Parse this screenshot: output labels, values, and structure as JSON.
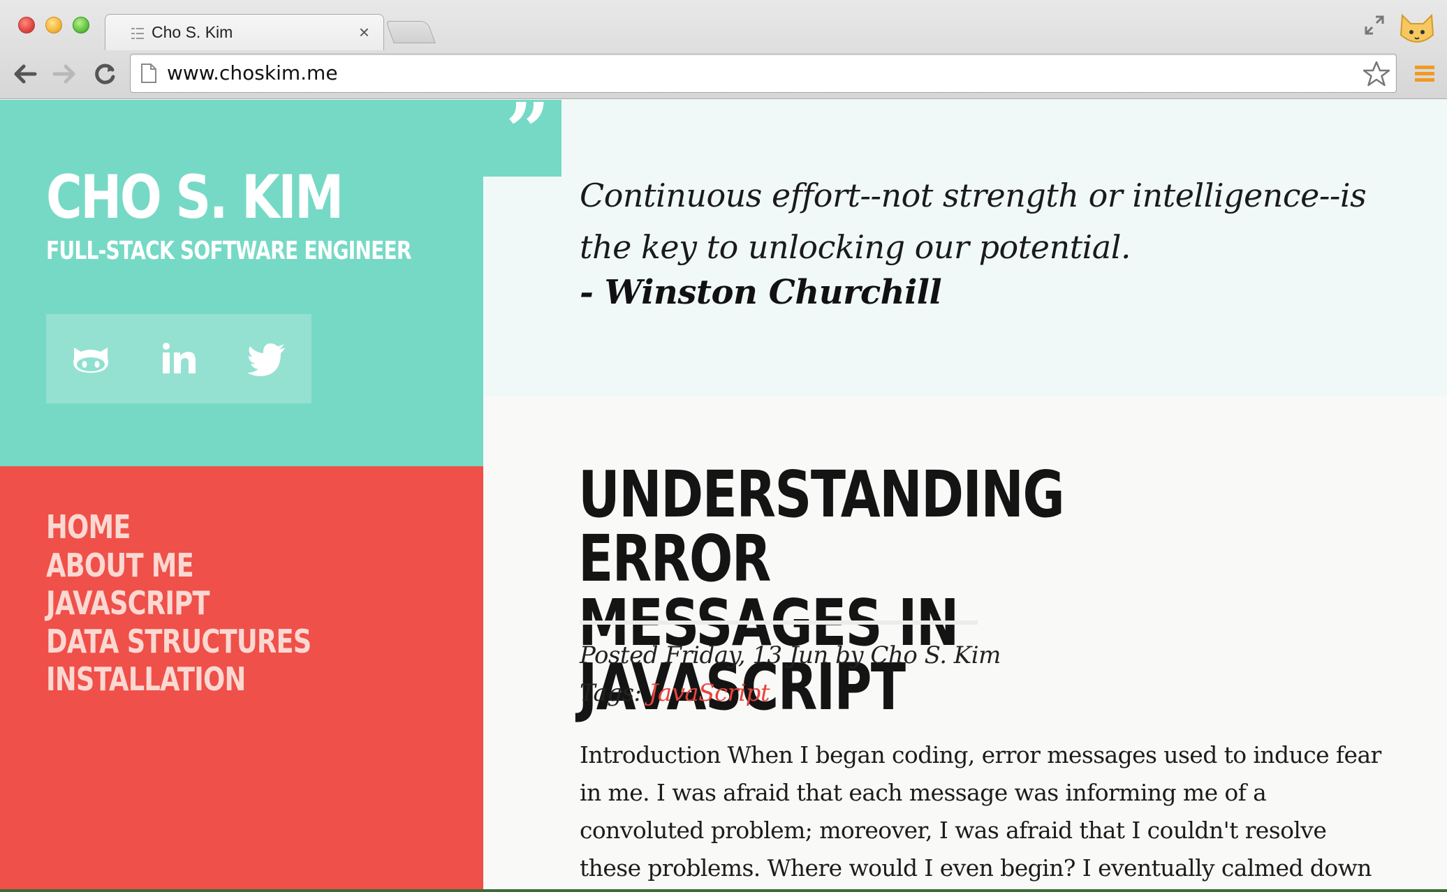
{
  "browser": {
    "tab_title": "Cho S. Kim",
    "tab_close": "×",
    "url": "www.choskim.me"
  },
  "site": {
    "name": "CHO S. KIM",
    "subtitle": "FULL-STACK SOFTWARE ENGINEER",
    "social": [
      "github-icon",
      "linkedin-icon",
      "twitter-icon"
    ]
  },
  "quote": {
    "mark": "”",
    "text": "Continuous effort--not strength or intelligence--is the key to unlocking our potential.",
    "author": "- Winston Churchill"
  },
  "nav": {
    "items": [
      {
        "label": "HOME"
      },
      {
        "label": "ABOUT ME"
      },
      {
        "label": "JAVASCRIPT"
      },
      {
        "label": "DATA STRUCTURES"
      },
      {
        "label": "INSTALLATION"
      }
    ]
  },
  "post": {
    "title_line1": "UNDERSTANDING ERROR",
    "title_line2": "MESSAGES IN JAVASCRIPT",
    "meta": "Posted Friday, 13 Jun by Cho S. Kim",
    "tags_label": "Tags: ",
    "tag": "JavaScript",
    "body": "Introduction When I began coding, error messages used to induce fear in me. I was afraid that each message was informing me of a convoluted problem; moreover, I was afraid that I couldn't resolve these problems. Where would I even begin? I eventually calmed down"
  },
  "colors": {
    "teal": "#76d9c5",
    "coral": "#ef5049",
    "quote_bg": "#f1f9f8",
    "tag_link": "#e8443c"
  }
}
